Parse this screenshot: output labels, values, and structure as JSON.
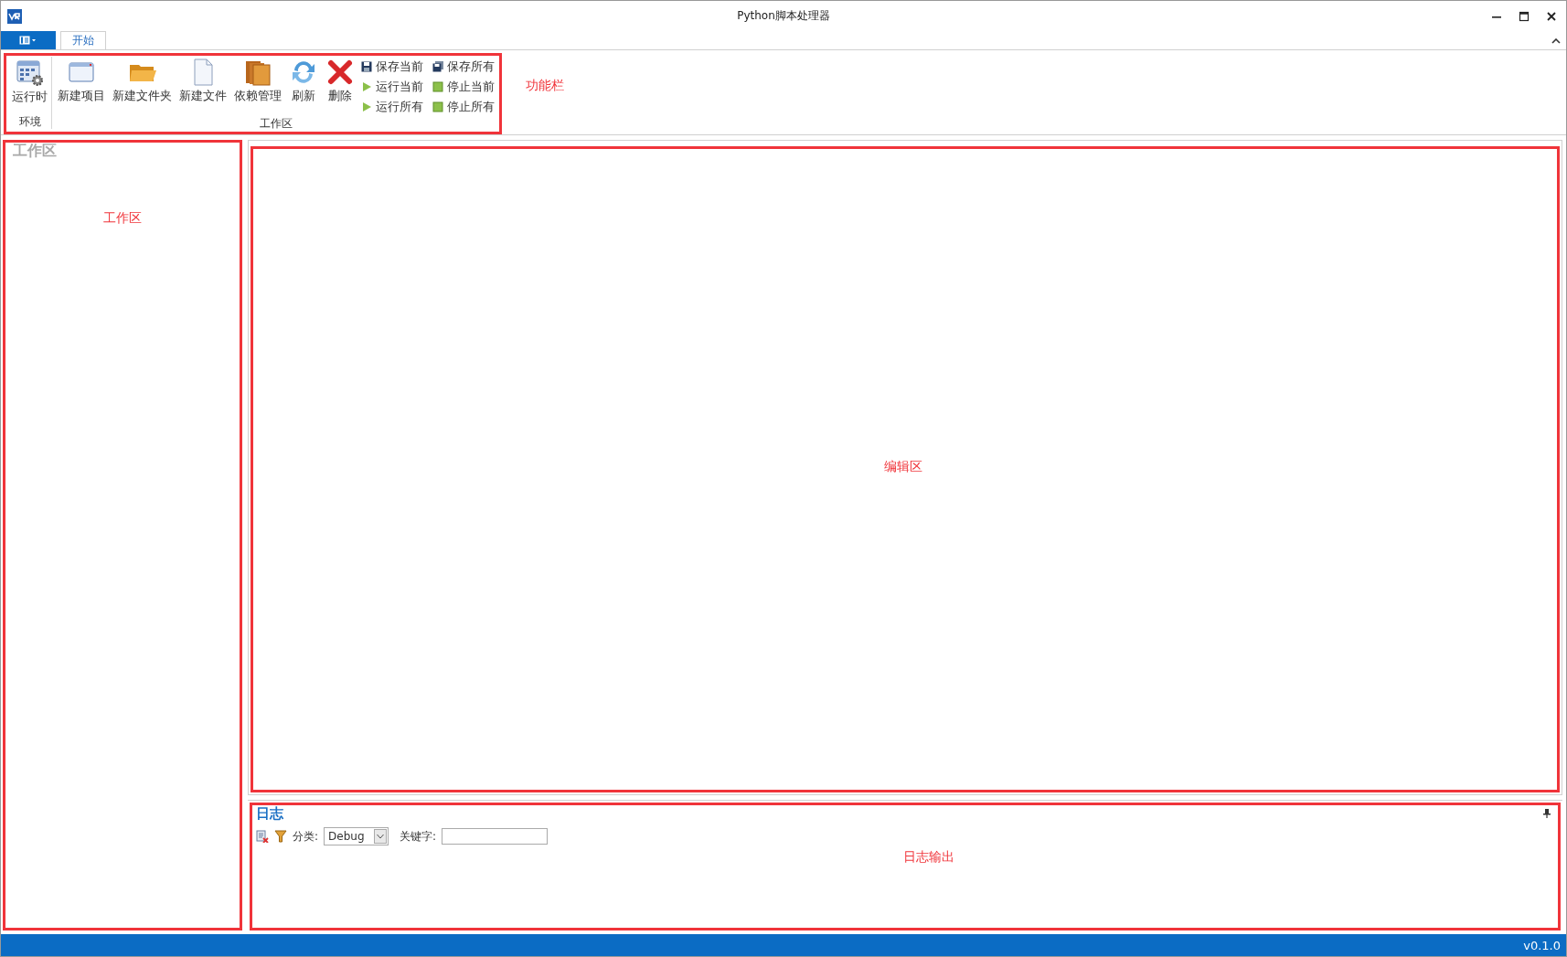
{
  "window": {
    "title": "Python脚本处理器"
  },
  "ribbon": {
    "annotation": "功能栏",
    "tabs": [
      {
        "label": "开始",
        "selected": true
      }
    ],
    "groups": [
      {
        "label": "环境",
        "buttons": [
          {
            "label": "运行时",
            "kind": "runtime"
          }
        ]
      },
      {
        "label": "工作区",
        "buttons": [
          {
            "label": "新建项目",
            "kind": "window"
          },
          {
            "label": "新建文件夹",
            "kind": "folder"
          },
          {
            "label": "新建文件",
            "kind": "file"
          },
          {
            "label": "依赖管理",
            "kind": "books"
          },
          {
            "label": "刷新",
            "kind": "refresh"
          },
          {
            "label": "删除",
            "kind": "delete"
          }
        ],
        "small_buttons": [
          {
            "label": "保存当前",
            "kind": "save"
          },
          {
            "label": "保存所有",
            "kind": "saveall"
          },
          {
            "label": "运行当前",
            "kind": "run"
          },
          {
            "label": "停止当前",
            "kind": "stop"
          },
          {
            "label": "运行所有",
            "kind": "run"
          },
          {
            "label": "停止所有",
            "kind": "stop"
          }
        ]
      }
    ]
  },
  "workspace": {
    "title": "工作区",
    "annotation": "工作区"
  },
  "editor": {
    "annotation": "编辑区"
  },
  "log": {
    "title": "日志",
    "annotation": "日志输出",
    "category_label": "分类:",
    "category_value": "Debug",
    "keyword_label": "关键字:"
  },
  "status_bar": {
    "version": "v0.1.0"
  }
}
